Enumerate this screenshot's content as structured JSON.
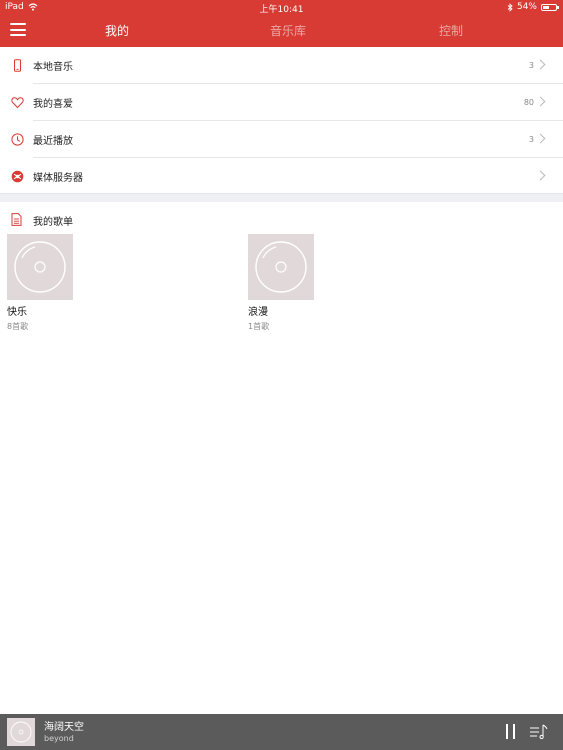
{
  "status_bar": {
    "device": "iPad",
    "time": "上午10:41",
    "battery": "54%",
    "battery_level": 0.54
  },
  "header": {
    "tabs": [
      {
        "label": "我的",
        "active": true
      },
      {
        "label": "音乐库",
        "active": false
      },
      {
        "label": "控制",
        "active": false
      }
    ],
    "accent_color": "#d83a34"
  },
  "list": [
    {
      "label": "本地音乐",
      "count": "3",
      "icon": "phone-icon"
    },
    {
      "label": "我的喜爱",
      "count": "80",
      "icon": "heart-icon"
    },
    {
      "label": "最近播放",
      "count": "3",
      "icon": "clock-icon"
    },
    {
      "label": "媒体服务器",
      "count": "",
      "icon": "media-server-icon"
    }
  ],
  "section": {
    "label": "我的歌单",
    "icon": "document-icon"
  },
  "playlists": [
    {
      "name": "快乐",
      "sub": "8首歌"
    },
    {
      "name": "浪漫",
      "sub": "1首歌"
    }
  ],
  "player": {
    "title": "海阔天空",
    "artist": "beyond"
  }
}
